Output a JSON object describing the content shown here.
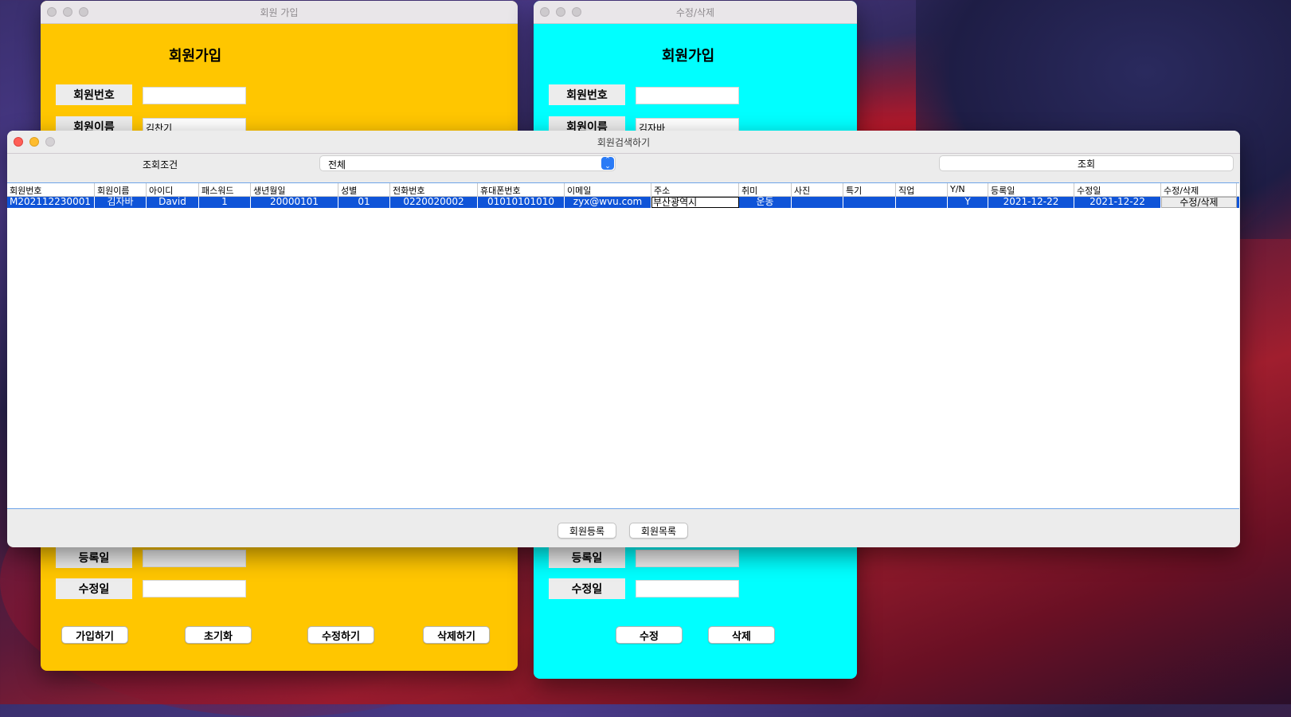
{
  "colors": {
    "join_bg": "#ffc600",
    "edit_bg": "#00ffff",
    "selection": "#0f54d8"
  },
  "join_window": {
    "title": "회원 가입",
    "heading": "회원가입",
    "labels": {
      "member_no": "회원번호",
      "member_name": "회원이름",
      "reg_date": "등록일",
      "mod_date": "수정일"
    },
    "values": {
      "member_no": "",
      "member_name": "김찬기",
      "reg_date": "",
      "mod_date": ""
    },
    "buttons": {
      "join": "가입하기",
      "reset": "초기화",
      "edit": "수정하기",
      "delete": "삭제하기"
    }
  },
  "edit_window": {
    "title": "수정/삭제",
    "heading": "회원가입",
    "labels": {
      "member_no": "회원번호",
      "member_name": "회원이름",
      "reg_date": "등록일",
      "mod_date": "수정일"
    },
    "values": {
      "member_no": "",
      "member_name": "김자바",
      "reg_date": "",
      "mod_date": ""
    },
    "buttons": {
      "edit": "수정",
      "delete": "삭제"
    }
  },
  "search_window": {
    "title": "회원검색하기",
    "condition_label": "조회조건",
    "condition_value": "전체",
    "query_button": "조회",
    "columns": [
      "회원번호",
      "회원이름",
      "아이디",
      "패스워드",
      "생년월일",
      "성별",
      "전화번호",
      "휴대폰번호",
      "이메일",
      "주소",
      "취미",
      "사진",
      "특기",
      "직업",
      "Y/N",
      "등록일",
      "수정일",
      "수정/삭제"
    ],
    "rows": [
      [
        "M202112230001",
        "김자바",
        "David",
        "1",
        "20000101",
        "01",
        "0220020002",
        "01010101010",
        "zyx@wvu.com",
        "부산광역시",
        "운동",
        "",
        "",
        "",
        "Y",
        "2021-12-22",
        "2021-12-22",
        "수정/삭제"
      ]
    ],
    "buttons": {
      "register": "회원등록",
      "list": "회원목록"
    }
  }
}
